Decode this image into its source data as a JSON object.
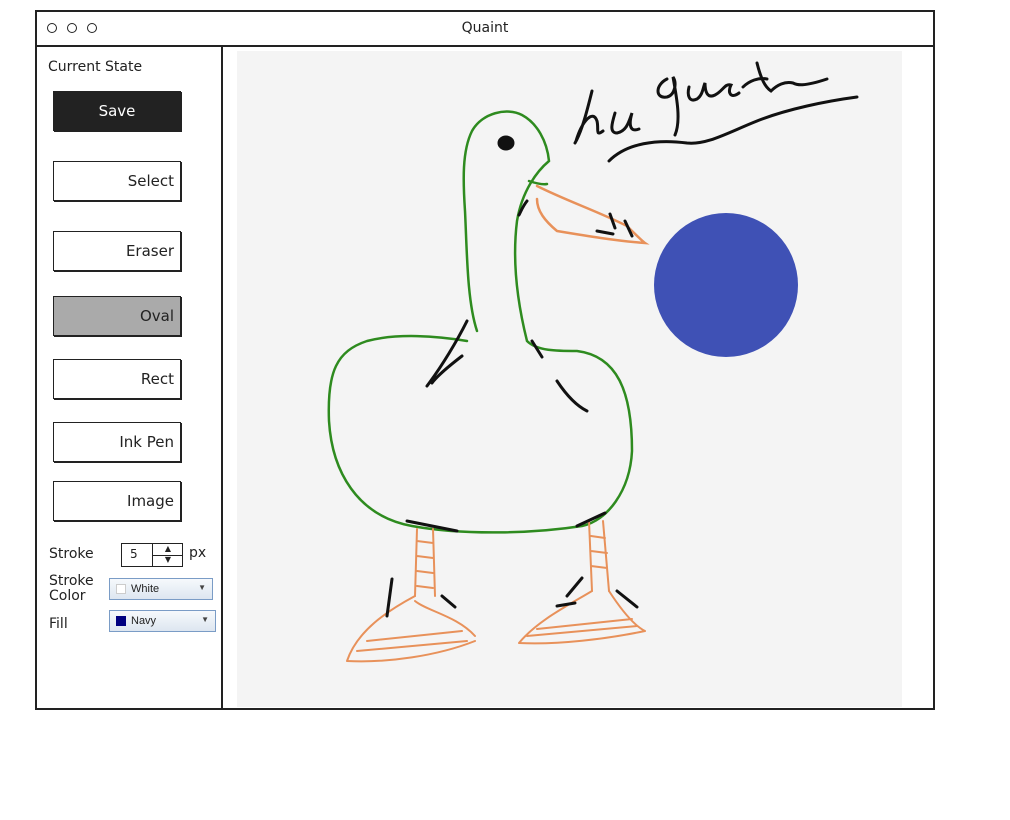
{
  "window": {
    "title": "Quaint"
  },
  "sidebar": {
    "heading": "Current State",
    "buttons": {
      "save": "Save",
      "select": "Select",
      "eraser": "Eraser",
      "oval": "Oval",
      "rect": "Rect",
      "ink_pen": "Ink Pen",
      "image": "Image"
    },
    "active_tool": "Oval",
    "stroke": {
      "label": "Stroke",
      "value": "5",
      "unit": "px"
    },
    "stroke_color": {
      "label": "Stroke Color",
      "selected": "White",
      "swatch": "#ffffff"
    },
    "fill": {
      "label": "Fill",
      "selected": "Navy",
      "swatch": "#000080"
    }
  },
  "canvas": {
    "handwriting": "le quack",
    "colors": {
      "outline": "#2e8b1f",
      "legs": "#e8915a",
      "ink": "#111111",
      "circle": "#3f51b5",
      "background": "#f4f4f4"
    }
  }
}
